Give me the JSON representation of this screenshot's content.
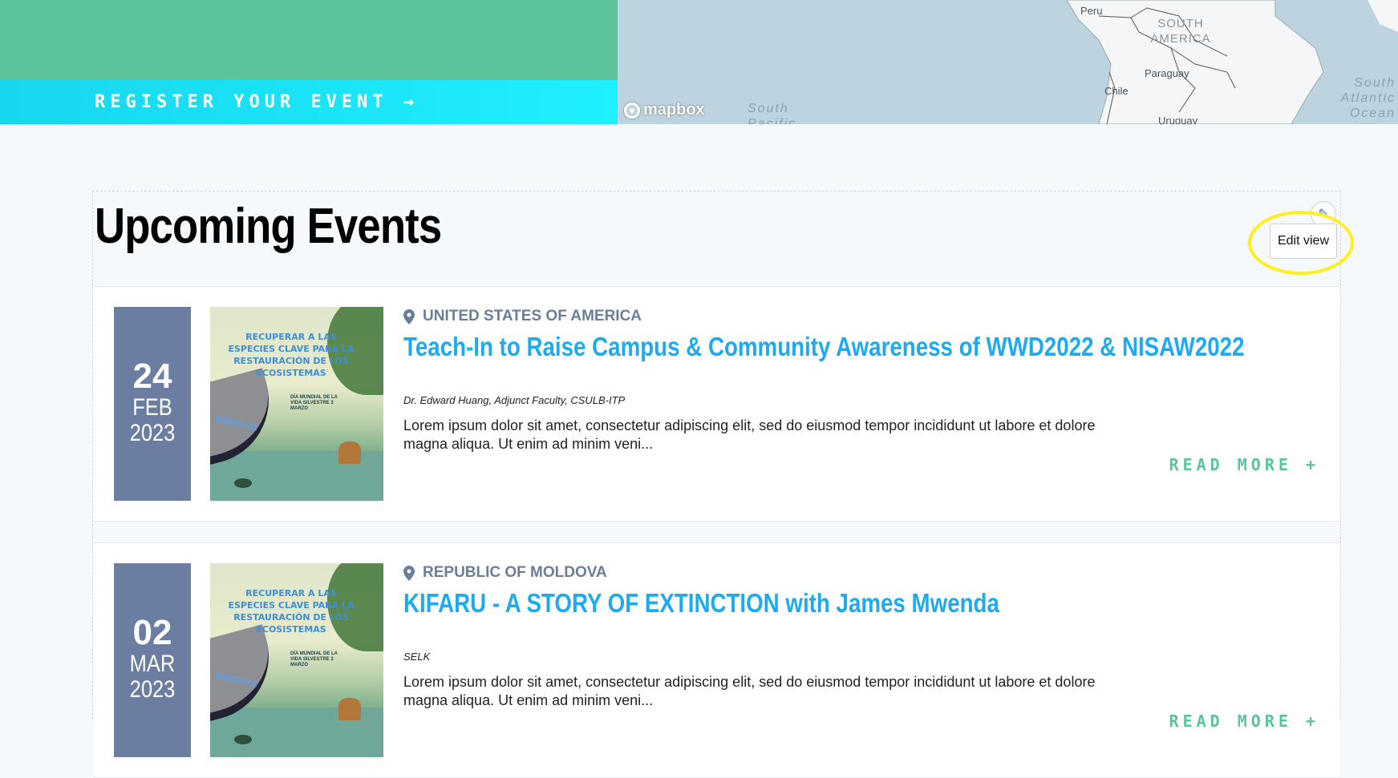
{
  "hero": {
    "register_label": "REGISTER YOUR EVENT →"
  },
  "map": {
    "attribution": "mapbox",
    "labels": {
      "peru": "Peru",
      "south_america": "SOUTH AMERICA",
      "paraguay": "Paraguay",
      "chile": "Chile",
      "uruguay": "Uruguay",
      "south_pacific": "South Pacific",
      "south_atlantic": "South Atlantic Ocean"
    },
    "colors": {
      "water": "#bdd3df",
      "land": "#f4f6f7"
    }
  },
  "events_section": {
    "title": "Upcoming Events",
    "edit_view_label": "Edit view",
    "edit_icon": "pencil-icon"
  },
  "events": [
    {
      "day": "24",
      "month": "FEB",
      "year": "2023",
      "thumb_text": "RECUPERAR A LAS ESPECIES CLAVE PARA LA RESTAURACIÓN DE LOS ECOSISTEMAS",
      "thumb_sub": "DÍA MUNDIAL DE LA VIDA SILVESTRE 3 MARZO",
      "thumb_tag": "WWD2022",
      "country": "UNITED STATES OF AMERICA",
      "title": "Teach-In to Raise Campus & Community Awareness of WWD2022 & NISAW2022",
      "organizer": "Dr. Edward Huang, Adjunct Faculty, CSULB-ITP",
      "description": "Lorem ipsum dolor sit amet, consectetur adipiscing elit, sed do eiusmod tempor incididunt ut labore et dolore magna aliqua. Ut enim ad minim veni...",
      "read_more": "READ MORE +"
    },
    {
      "day": "02",
      "month": "MAR",
      "year": "2023",
      "thumb_text": "RECUPERAR A LAS ESPECIES CLAVE PARA LA RESTAURACIÓN DE LOS ECOSISTEMAS",
      "thumb_sub": "DÍA MUNDIAL DE LA VIDA SILVESTRE 3 MARZO",
      "thumb_tag": "WWD2022",
      "country": "REPUBLIC OF MOLDOVA",
      "title": "KIFARU - A STORY OF EXTINCTION with James Mwenda",
      "organizer": "SELK",
      "description": "Lorem ipsum dolor sit amet, consectetur adipiscing elit, sed do eiusmod tempor incididunt ut labore et dolore magna aliqua. Ut enim ad minim veni...",
      "read_more": "READ MORE +"
    }
  ],
  "theme": {
    "green": "#5cc39b",
    "cyan": "#1ef0ff",
    "title_blue": "#1eaaf0",
    "date_box": "#6b7da0",
    "highlight": "#ffef1c"
  }
}
